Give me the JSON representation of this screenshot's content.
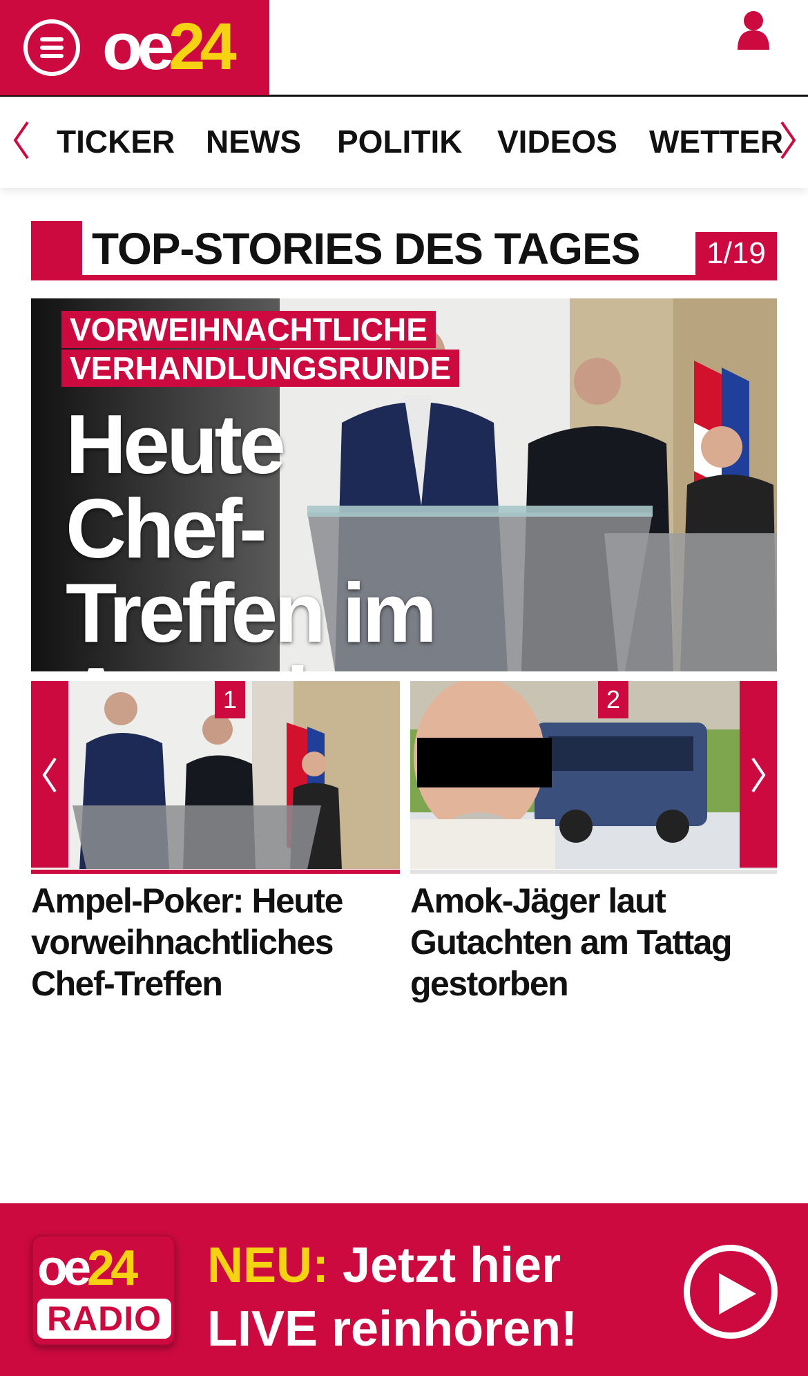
{
  "header": {
    "logo_oe": "oe",
    "logo_num": "24",
    "menu_icon": "hamburger-menu-icon",
    "user_icon": "user-icon"
  },
  "nav": {
    "items": [
      "TICKER",
      "NEWS",
      "POLITIK",
      "VIDEOS",
      "WETTER"
    ],
    "prev_icon": "chevron-left-icon",
    "next_icon": "chevron-right-icon"
  },
  "section": {
    "title": "TOP-STORIES DES TAGES",
    "counter": "1/19"
  },
  "hero": {
    "kicker_line1": "VORWEIHNACHTLICHE",
    "kicker_line2": "VERHANDLUNGSRUNDE",
    "title": "Heute Chef-Treffen im Ampel-Poker"
  },
  "stories": [
    {
      "number": "1",
      "title": "Ampel-Poker: Heute vorweihnachtliches Chef-Treffen"
    },
    {
      "number": "2",
      "title": "Amok-Jäger laut Gutachten am Tattag gestorben"
    }
  ],
  "radio": {
    "logo_oe": "oe",
    "logo_num": "24",
    "logo_label": "RADIO",
    "neu": "NEU:",
    "line1_rest": " Jetzt hier",
    "line2": "LIVE reinhören!",
    "play_icon": "play-icon"
  },
  "colors": {
    "brand_red": "#cc0a3f",
    "brand_yellow": "#f6d312"
  }
}
